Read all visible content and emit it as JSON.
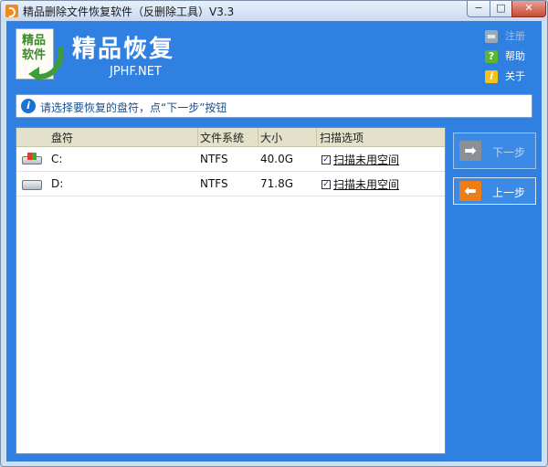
{
  "window": {
    "title": "精品删除文件恢复软件（反删除工具）V3.3",
    "minimize_glyph": "−",
    "maximize_glyph": "□",
    "close_glyph": "✕"
  },
  "header": {
    "logo_text_top": "精品",
    "logo_text_bottom": "软件",
    "app_name": "精品恢复",
    "site": "JPHF.NET",
    "links": {
      "register": "注册",
      "help": "帮助",
      "about": "关于"
    },
    "link_icons": {
      "register": "cart-icon",
      "help": "question-icon",
      "about": "info-icon"
    }
  },
  "info": {
    "icon_glyph": "i",
    "text": "请选择要恢复的盘符，点“下一步”按钮"
  },
  "table": {
    "columns": [
      "盘符",
      "文件系统",
      "大小",
      "扫描选项"
    ],
    "rows": [
      {
        "drive": "C:",
        "fs": "NTFS",
        "size": "40.0G",
        "scan_label": "扫描未用空间",
        "scan_checked": true,
        "icon": "system-drive-icon"
      },
      {
        "drive": "D:",
        "fs": "NTFS",
        "size": "71.8G",
        "scan_label": "扫描未用空间",
        "scan_checked": true,
        "icon": "hard-drive-icon"
      }
    ]
  },
  "buttons": {
    "next_label": "下一步",
    "next_enabled": false,
    "prev_label": "上一步",
    "next_glyph": "➡",
    "prev_glyph": "⬅"
  },
  "colors": {
    "client_bg": "#2f80e0",
    "header_row": "#e4e1cb",
    "info_text": "#1a4f8c",
    "prev_icon": "#ee7d16",
    "disabled_icon": "#8b8f96"
  }
}
